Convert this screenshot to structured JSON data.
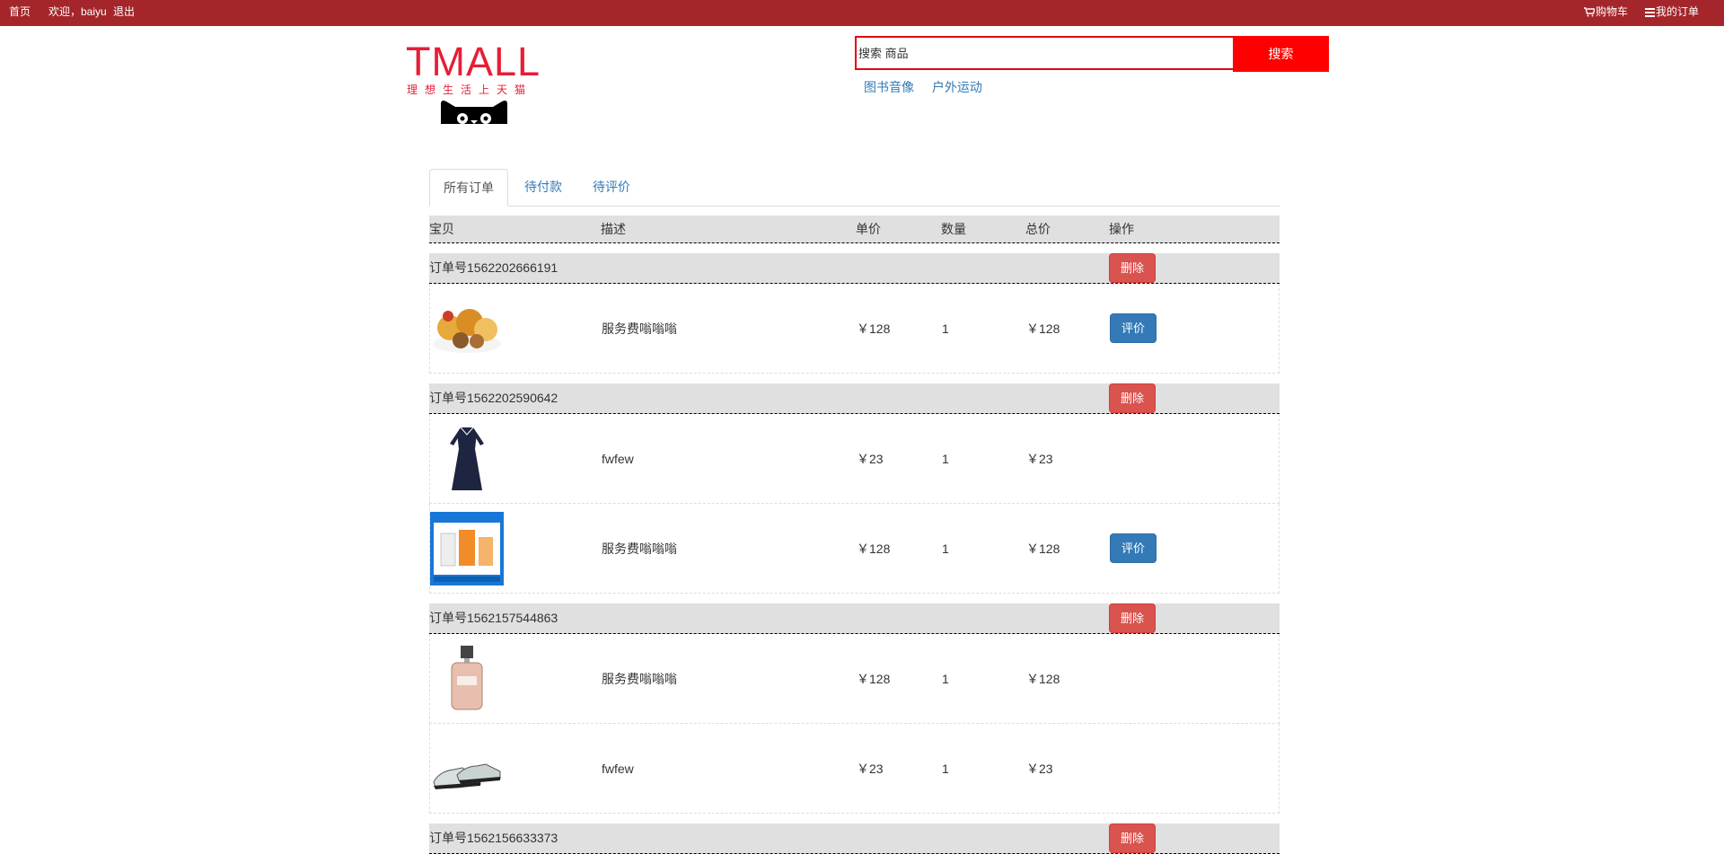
{
  "topbar": {
    "home": "首页",
    "welcome": "欢迎，baiyu",
    "logout": "退出",
    "cart": "购物车",
    "my_orders": "我的订单"
  },
  "logo": {
    "brand": "TMALL",
    "slogan": "理想生活上天猫"
  },
  "search": {
    "placeholder": "搜索 商品",
    "button": "搜索",
    "hot_links": [
      "图书音像",
      "户外运动"
    ]
  },
  "tabs": [
    "所有订单",
    "待付款",
    "待评价"
  ],
  "table": {
    "headers": {
      "item": "宝贝",
      "desc": "描述",
      "price": "单价",
      "qty": "数量",
      "total": "总价",
      "op": "操作"
    }
  },
  "labels": {
    "delete": "删除",
    "review": "评价"
  },
  "orders": [
    {
      "number": "订单号1562202666191",
      "items": [
        {
          "image": "snack-food-image",
          "desc": "服务费嗡嗡嗡",
          "price": "￥128",
          "qty": "1",
          "total": "￥128",
          "action": "评价"
        }
      ]
    },
    {
      "number": "订单号1562202590642",
      "items": [
        {
          "image": "navy-dress-image",
          "desc": "fwfew",
          "price": "￥23",
          "qty": "1",
          "total": "￥23",
          "action": ""
        },
        {
          "image": "skincare-box-image",
          "desc": "服务费嗡嗡嗡",
          "price": "￥128",
          "qty": "1",
          "total": "￥128",
          "action": "评价"
        }
      ]
    },
    {
      "number": "订单号1562157544863",
      "items": [
        {
          "image": "perfume-bottle-image",
          "desc": "服务费嗡嗡嗡",
          "price": "￥128",
          "qty": "1",
          "total": "￥128",
          "action": ""
        },
        {
          "image": "sneakers-image",
          "desc": "fwfew",
          "price": "￥23",
          "qty": "1",
          "total": "￥23",
          "action": ""
        }
      ]
    },
    {
      "number": "订单号1562156633373",
      "items": []
    }
  ],
  "colors": {
    "topbar": "#a4262b",
    "brand_red": "#e61e36",
    "search_red": "#ff0000",
    "delete": "#d9534f",
    "review": "#337ab7"
  }
}
